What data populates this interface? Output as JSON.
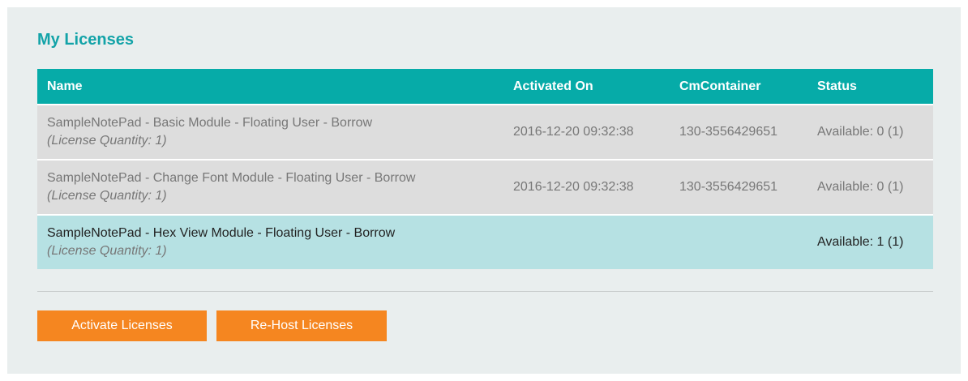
{
  "title": "My Licenses",
  "table": {
    "headers": {
      "name": "Name",
      "activated_on": "Activated On",
      "cm_container": "CmContainer",
      "status": "Status"
    },
    "rows": [
      {
        "name": "SampleNotePad - Basic Module - Floating User - Borrow",
        "quantity": "(License Quantity: 1)",
        "activated_on": "2016-12-20 09:32:38",
        "cm_container": "130-3556429651",
        "status": "Available: 0 (1)"
      },
      {
        "name": "SampleNotePad - Change Font Module - Floating User - Borrow",
        "quantity": "(License Quantity: 1)",
        "activated_on": "2016-12-20 09:32:38",
        "cm_container": "130-3556429651",
        "status": "Available: 0 (1)"
      },
      {
        "name": "SampleNotePad - Hex View Module - Floating User - Borrow",
        "quantity": "(License Quantity: 1)",
        "activated_on": "",
        "cm_container": "",
        "status": "Available: 1 (1)",
        "selected": true
      }
    ]
  },
  "buttons": {
    "activate": "Activate Licenses",
    "rehost": "Re-Host Licenses"
  },
  "colors": {
    "title": "#13a3a8",
    "header_bg": "#06aba8",
    "row_bg": "#dddddd",
    "selected_row_bg": "#b6e1e3",
    "button_bg": "#f58620"
  }
}
